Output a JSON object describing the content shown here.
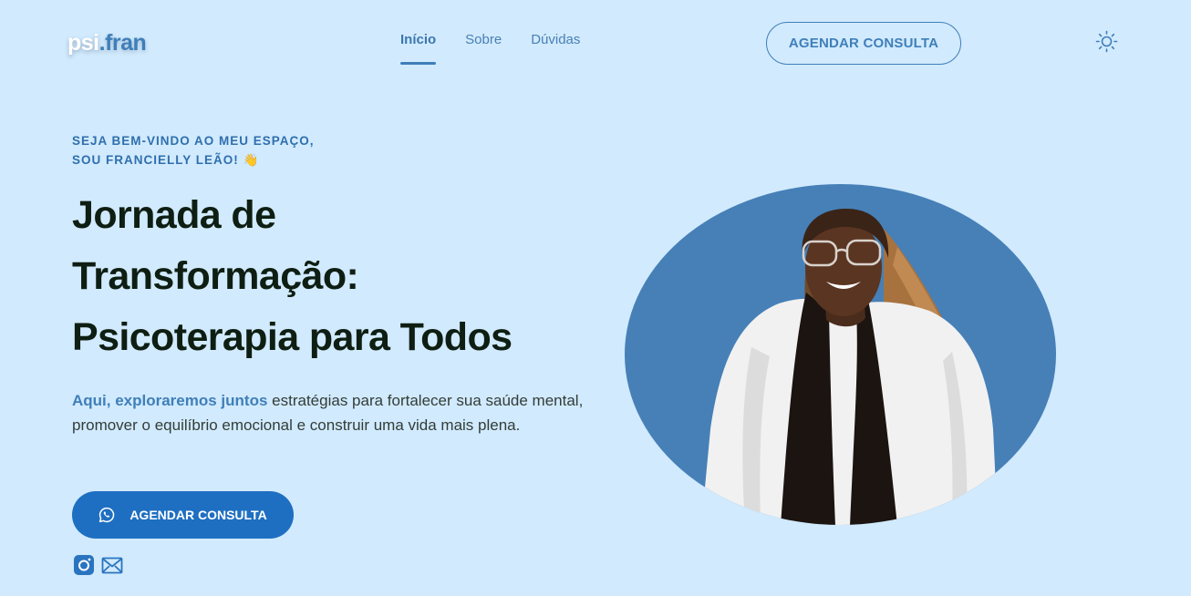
{
  "header": {
    "logo_main": "psi",
    "logo_accent": ".fran",
    "nav": [
      {
        "label": "Início",
        "active": true
      },
      {
        "label": "Sobre",
        "active": false
      },
      {
        "label": "Dúvidas",
        "active": false
      }
    ],
    "cta_label": "AGENDAR CONSULTA",
    "theme_icon": "sun-icon"
  },
  "hero": {
    "eyebrow_line1": "SEJA BEM-VINDO AO MEU ESPAÇO,",
    "eyebrow_line2": "SOU FRANCIELLY LEÃO! 👋",
    "headline_line1": "Jornada de",
    "headline_line2": "Transformação:",
    "headline_line3": "Psicoterapia para Todos",
    "description_highlight": "Aqui, exploraremos juntos",
    "description_rest": " estratégias para fortalecer sua saúde mental, promover o equilíbrio emocional e construir uma vida mais plena.",
    "cta_label": "AGENDAR CONSULTA",
    "cta_icon": "whatsapp-icon",
    "social_icons": [
      "instagram-icon",
      "email-icon"
    ]
  },
  "colors": {
    "background": "#d1eafd",
    "accent": "#3f7fb9",
    "button": "#1e6fc1",
    "portrait_circle": "#4680b7",
    "heading": "#0e1e12"
  }
}
